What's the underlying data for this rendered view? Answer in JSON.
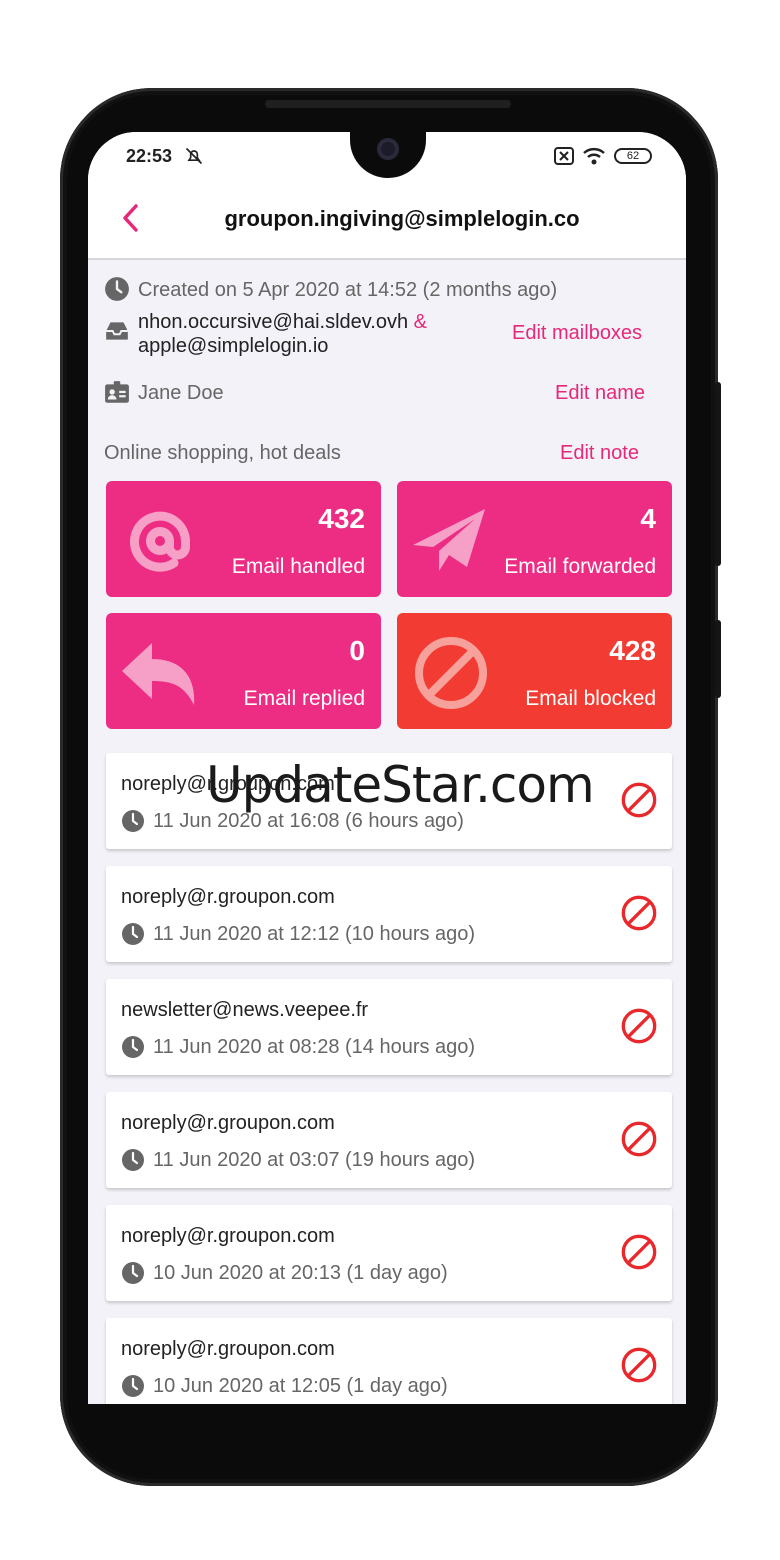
{
  "status": {
    "time": "22:53",
    "battery": "62"
  },
  "header": {
    "title": "groupon.ingiving@simplelogin.co"
  },
  "alias": {
    "created": "Created on 5 Apr 2020 at 14:52 (2 months ago)",
    "mailbox_1": "nhon.occursive@hai.sldev.ovh",
    "mailbox_sep": "&",
    "mailbox_2": "apple@simplelogin.io",
    "edit_mailboxes": "Edit mailboxes",
    "name": "Jane Doe",
    "edit_name": "Edit name",
    "note": "Online shopping, hot deals",
    "edit_note": "Edit note"
  },
  "stats": [
    {
      "count": "432",
      "label": "Email handled",
      "icon": "at-icon",
      "color": "#ec2d83"
    },
    {
      "count": "4",
      "label": "Email forwarded",
      "icon": "paper-plane-icon",
      "color": "#ec2d83"
    },
    {
      "count": "0",
      "label": "Email replied",
      "icon": "reply-icon",
      "color": "#ec2d83"
    },
    {
      "count": "428",
      "label": "Email blocked",
      "icon": "block-icon",
      "color": "#f23c33"
    }
  ],
  "activities": [
    {
      "from": "noreply@r.groupon.com",
      "time": "11 Jun 2020 at 16:08 (6 hours ago)"
    },
    {
      "from": "noreply@r.groupon.com",
      "time": "11 Jun 2020 at 12:12 (10 hours ago)"
    },
    {
      "from": "newsletter@news.veepee.fr",
      "time": "11 Jun 2020 at 08:28 (14 hours ago)"
    },
    {
      "from": "noreply@r.groupon.com",
      "time": "11 Jun 2020 at 03:07 (19 hours ago)"
    },
    {
      "from": "noreply@r.groupon.com",
      "time": "10 Jun 2020 at 20:13 (1 day ago)"
    },
    {
      "from": "noreply@r.groupon.com",
      "time": "10 Jun 2020 at 12:05 (1 day ago)"
    }
  ],
  "watermark": "UpdateStar.com",
  "colors": {
    "accent": "#e6287a",
    "blocked": "#f23c33",
    "block_icon": "#e8282b"
  }
}
